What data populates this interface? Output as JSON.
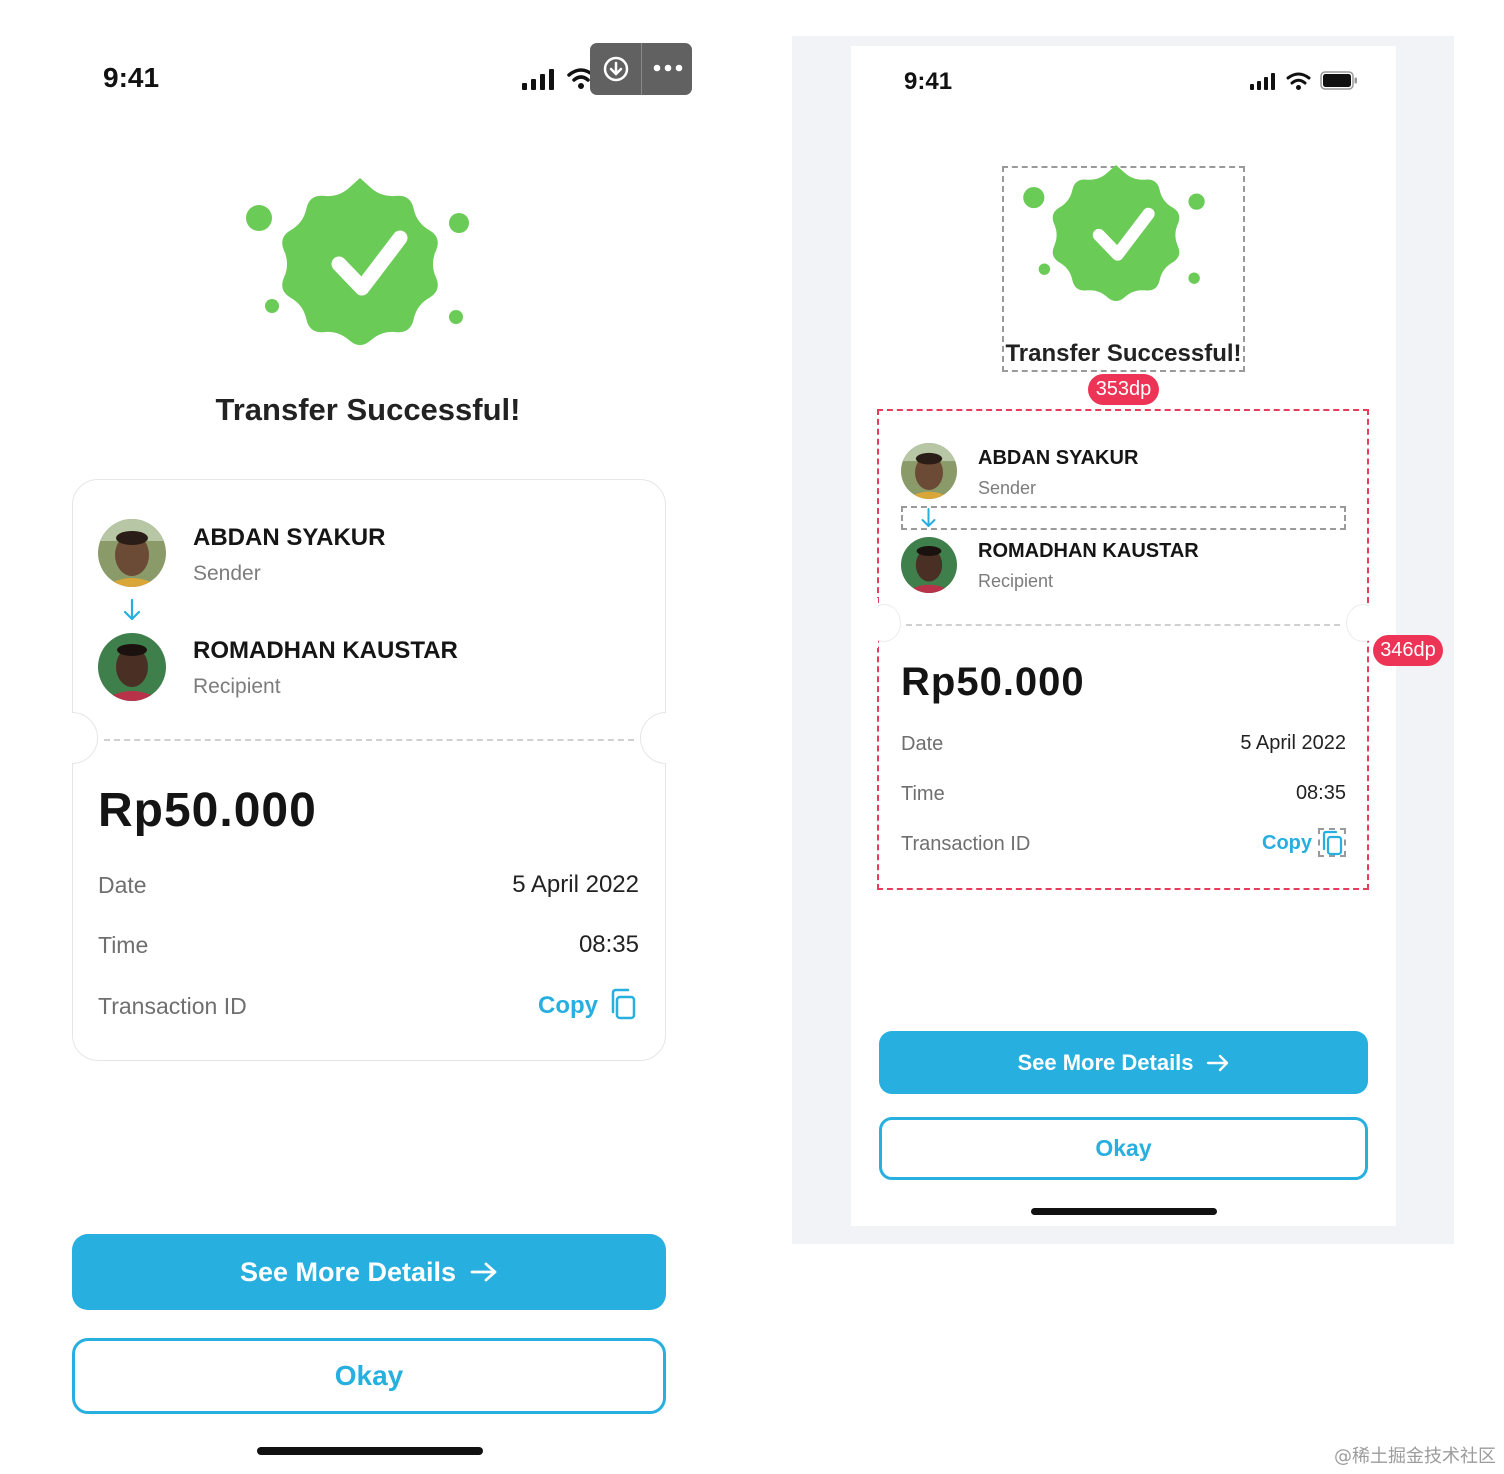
{
  "colors": {
    "accent": "#26afdf",
    "success": "#6bcb57",
    "guide_red": "#ee3456",
    "frame_bg": "#f2f3f6"
  },
  "left": {
    "status": {
      "time": "9:41"
    },
    "title": "Transfer Successful!",
    "sender": {
      "name": "ABDAN SYAKUR",
      "role": "Sender"
    },
    "recipient": {
      "name": "ROMADHAN KAUSTAR",
      "role": "Recipient"
    },
    "amount": "Rp50.000",
    "rows": [
      {
        "label": "Date",
        "value": "5 April 2022"
      },
      {
        "label": "Time",
        "value": "08:35"
      }
    ],
    "txn_label": "Transaction ID",
    "copy_label": "Copy",
    "primary_button": "See More Details",
    "secondary_button": "Okay"
  },
  "right": {
    "status": {
      "time": "9:41"
    },
    "title": "Transfer Successful!",
    "width_badge": "353dp",
    "height_badge": "346dp",
    "sender": {
      "name": "ABDAN SYAKUR",
      "role": "Sender"
    },
    "recipient": {
      "name": "ROMADHAN KAUSTAR",
      "role": "Recipient"
    },
    "amount": "Rp50.000",
    "rows": [
      {
        "label": "Date",
        "value": "5 April 2022"
      },
      {
        "label": "Time",
        "value": "08:35"
      }
    ],
    "txn_label": "Transaction ID",
    "copy_label": "Copy",
    "primary_button": "See More Details",
    "secondary_button": "Okay"
  },
  "watermark": "@稀土掘金技术社区"
}
